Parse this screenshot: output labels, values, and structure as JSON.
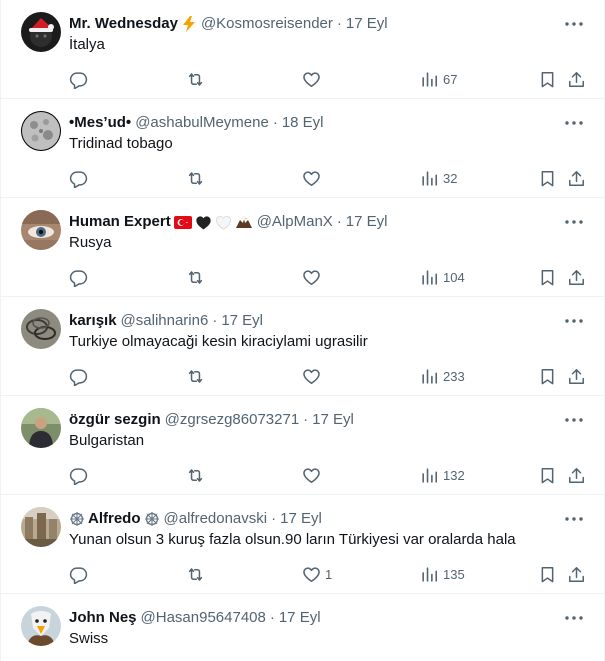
{
  "tweets": [
    {
      "name": "Mr. Wednesday",
      "badge_icon": "lightning-emoji",
      "handle": "@Kosmosreisender",
      "separator": "·",
      "date": "17 Eyl",
      "text": "İtalya",
      "replies": "",
      "retweets": "",
      "likes": "",
      "views": "67"
    },
    {
      "name": "•Mes’ud•",
      "badge_icon": "",
      "handle": "@ashabulMeymene",
      "separator": "·",
      "date": "18 Eyl",
      "text": "Tridinad tobago",
      "replies": "",
      "retweets": "",
      "likes": "",
      "views": "32"
    },
    {
      "name": "Human Expert",
      "badge_icon": "turkey-flag-black-heart-white-heart-eagle-emoji",
      "handle": "@AlpManX",
      "separator": "·",
      "date": "17 Eyl",
      "text": "Rusya",
      "replies": "",
      "retweets": "",
      "likes": "",
      "views": "104"
    },
    {
      "name": "karışık",
      "badge_icon": "",
      "handle": "@salihnarin6",
      "separator": "·",
      "date": "17 Eyl",
      "text": "Turkiye olmayacaği kesin kiraciylami ugrasilir",
      "replies": "",
      "retweets": "",
      "likes": "",
      "views": "233"
    },
    {
      "name": "özgür sezgin",
      "badge_icon": "",
      "handle": "@zgrsezg86073271",
      "separator": "·",
      "date": "17 Eyl",
      "text": "Bulgaristan",
      "replies": "",
      "retweets": "",
      "likes": "",
      "views": "132"
    },
    {
      "name": "Alfredo",
      "badge_icon": "wheel-of-dharma-emoji",
      "handle": "@alfredonavski",
      "separator": "·",
      "date": "17 Eyl",
      "text": "Yunan olsun 3 kuruş fazla olsun.90 ların Türkiyesi var oralarda  hala",
      "replies": "",
      "retweets": "",
      "likes": "1",
      "views": "135"
    },
    {
      "name": "John Neş",
      "badge_icon": "",
      "handle": "@Hasan95647408",
      "separator": "·",
      "date": "17 Eyl",
      "text": "Swiss",
      "replies": "",
      "retweets": "",
      "likes": "",
      "views": ""
    }
  ],
  "colors": {
    "text_primary": "#0f1419",
    "text_secondary": "#536471",
    "divider": "#eff3f4",
    "lightning": "#f4a300",
    "flag_red": "#e30a17"
  },
  "icons": {
    "reply": "reply-bubble-icon",
    "retweet": "retweet-icon",
    "like": "heart-icon",
    "views": "bar-chart-icon",
    "bookmark": "bookmark-icon",
    "share": "share-icon",
    "more": "more-dots-icon"
  }
}
